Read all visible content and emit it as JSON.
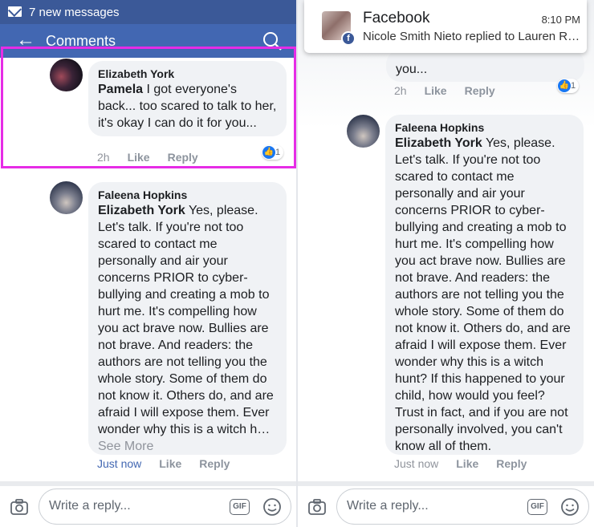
{
  "left": {
    "status_text": "7 new messages",
    "header_title": "Comments",
    "back_glyph": "←",
    "comment1": {
      "author": "Elizabeth York",
      "tag": "Pamela",
      "text": " I got everyone's back... too scared to talk to her, it's okay I can do it for you...",
      "time": "2h",
      "like": "Like",
      "reply": "Reply",
      "reaction_count": "1"
    },
    "comment2": {
      "author": "Faleena Hopkins",
      "tag": "Elizabeth York",
      "text": " Yes, please. Let's talk. If you're not too scared to contact me personally and air your concerns PRIOR to cyber-bullying and creating a mob to hurt me. It's compelling how you act brave now. Bullies are not brave. And readers: the authors are not telling you the whole story. Some of them do not know it. Others do, and are afraid I will expose them. Ever wonder why this is a witch h…",
      "see_more": "See More",
      "time": "Just now",
      "like": "Like",
      "reply": "Reply"
    },
    "reply_placeholder": "Write a reply...",
    "gif_label": "GIF"
  },
  "right": {
    "notification": {
      "app": "Facebook",
      "time": "8:10 PM",
      "message": "Nicole Smith Nieto replied to Lauren Rei…"
    },
    "prev_comment": {
      "text": "you...",
      "time": "2h",
      "like": "Like",
      "reply": "Reply",
      "reaction_count": "1"
    },
    "comment": {
      "author": "Faleena Hopkins",
      "tag": "Elizabeth York",
      "text": " Yes, please. Let's talk. If you're not too scared to contact me personally and air your concerns PRIOR to cyber-bullying and creating a mob to hurt me. It's compelling how you act brave now. Bullies are not brave. And readers: the authors are not telling you the whole story. Some of them do not know it. Others do, and are afraid I will expose them. Ever wonder why this is a witch hunt? If this happened to your child, how would you feel? Trust in fact, and if you are not personally involved, you can't know all of them.",
      "time": "Just now",
      "like": "Like",
      "reply": "Reply"
    },
    "reply_placeholder": "Write a reply...",
    "gif_label": "GIF"
  },
  "colors": {
    "status_bar": "#3b5998",
    "app_bar": "#4267b2",
    "highlight": "#e62ce6",
    "like_blue": "#1877f2"
  },
  "icons": [
    "mail-icon",
    "back-arrow-icon",
    "search-icon",
    "like-icon",
    "camera-icon",
    "gif-icon",
    "emoji-icon",
    "facebook-badge-icon"
  ]
}
